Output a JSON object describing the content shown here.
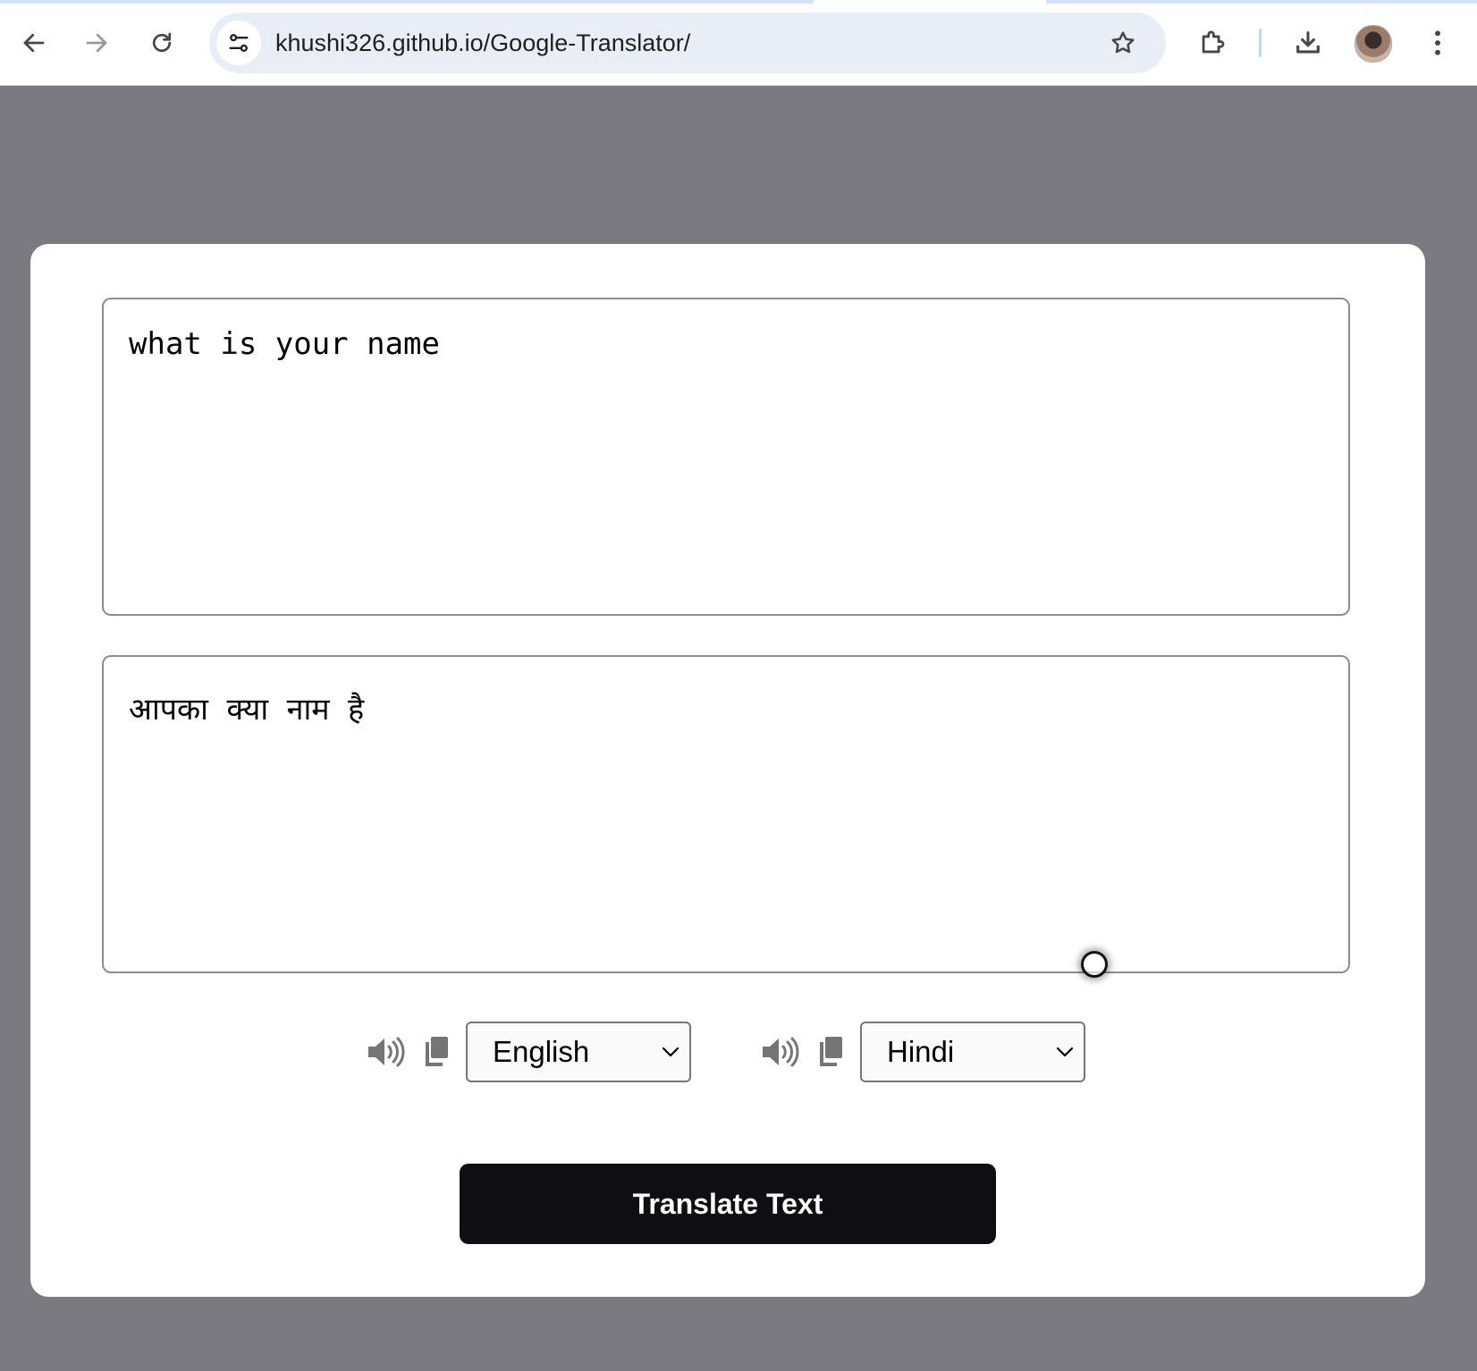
{
  "browser": {
    "url": "khushi326.github.io/Google-Translator/"
  },
  "translator": {
    "from_text": "what is your name",
    "to_text": "आपका क्या नाम है",
    "from_language": "English",
    "to_language": "Hindi",
    "translate_button_label": "Translate Text"
  },
  "icons": {
    "speak": "speaker-icon",
    "copy": "copy-icon"
  },
  "colors": {
    "page_background": "#7b7a80",
    "button_background": "#0f0e12",
    "button_text": "#ffffff"
  }
}
